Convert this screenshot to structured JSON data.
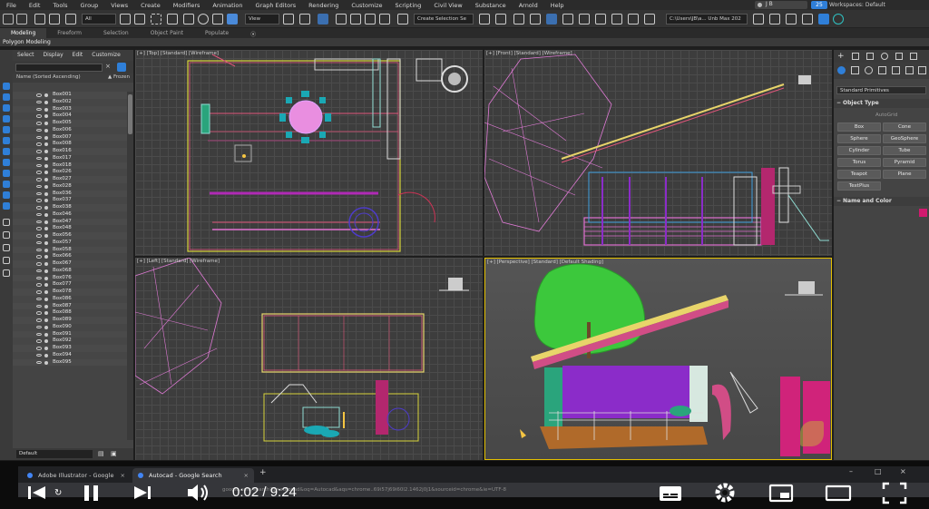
{
  "menu": [
    "File",
    "Edit",
    "Tools",
    "Group",
    "Views",
    "Create",
    "Modifiers",
    "Animation",
    "Graph Editors",
    "Rendering",
    "Customize",
    "Scripting",
    "Civil View",
    "Substance",
    "Arnold",
    "Help"
  ],
  "account": {
    "user": "J B",
    "badge": "25",
    "workspace_label": "Workspaces:",
    "workspace_value": "Default"
  },
  "toolbar": {
    "filter": "All",
    "view": "View",
    "selection_set": "Create Selection Se",
    "path": "C:\\Users\\JB\\a... Unb Max 202"
  },
  "ribbon": {
    "tabs": [
      "Modeling",
      "Freeform",
      "Selection",
      "Object Paint",
      "Populate"
    ],
    "sub": "Polygon Modeling"
  },
  "explorer": {
    "menu": [
      "Select",
      "Display",
      "Edit",
      "Customize"
    ],
    "header_name": "Name (Sorted Ascending)",
    "header_frozen": "▲ Frozen",
    "items": [
      "Box001",
      "Box002",
      "Box003",
      "Box004",
      "Box005",
      "Box006",
      "Box007",
      "Box008",
      "Box016",
      "Box017",
      "Box018",
      "Box026",
      "Box027",
      "Box028",
      "Box036",
      "Box037",
      "Box038",
      "Box046",
      "Box047",
      "Box048",
      "Box056",
      "Box057",
      "Box058",
      "Box066",
      "Box067",
      "Box068",
      "Box076",
      "Box077",
      "Box078",
      "Box086",
      "Box087",
      "Box088",
      "Box089",
      "Box090",
      "Box091",
      "Box092",
      "Box093",
      "Box094",
      "Box095"
    ],
    "layer": "Default"
  },
  "viewports": {
    "top": "[+] [Top] [Standard] [Wireframe]",
    "front": "[+] [Front] [Standard] [Wireframe]",
    "left": "[+] [Left] [Standard] [Wireframe]",
    "persp": "[+] [Perspective] [Standard] [Default Shading]"
  },
  "command_panel": {
    "category": "Standard Primitives",
    "object_type": "Object Type",
    "autogrid": "AutoGrid",
    "buttons": [
      "Box",
      "Cone",
      "Sphere",
      "GeoSphere",
      "Cylinder",
      "Tube",
      "Torus",
      "Pyramid",
      "Teapot",
      "Plane",
      "TextPlus"
    ],
    "name_color": "Name and Color",
    "color": "#d11a6e"
  },
  "browser": {
    "tabs": [
      "Adobe Illustrator - Google Search",
      "Autocad - Google Search"
    ],
    "url": "google.com/search?q=autocad&oq=Autocad&aqs=chrome..69i57j69i60l2.1462j0j1&sourceid=chrome&ie=UTF-8"
  },
  "player": {
    "time": "0:02 / 9:24"
  }
}
